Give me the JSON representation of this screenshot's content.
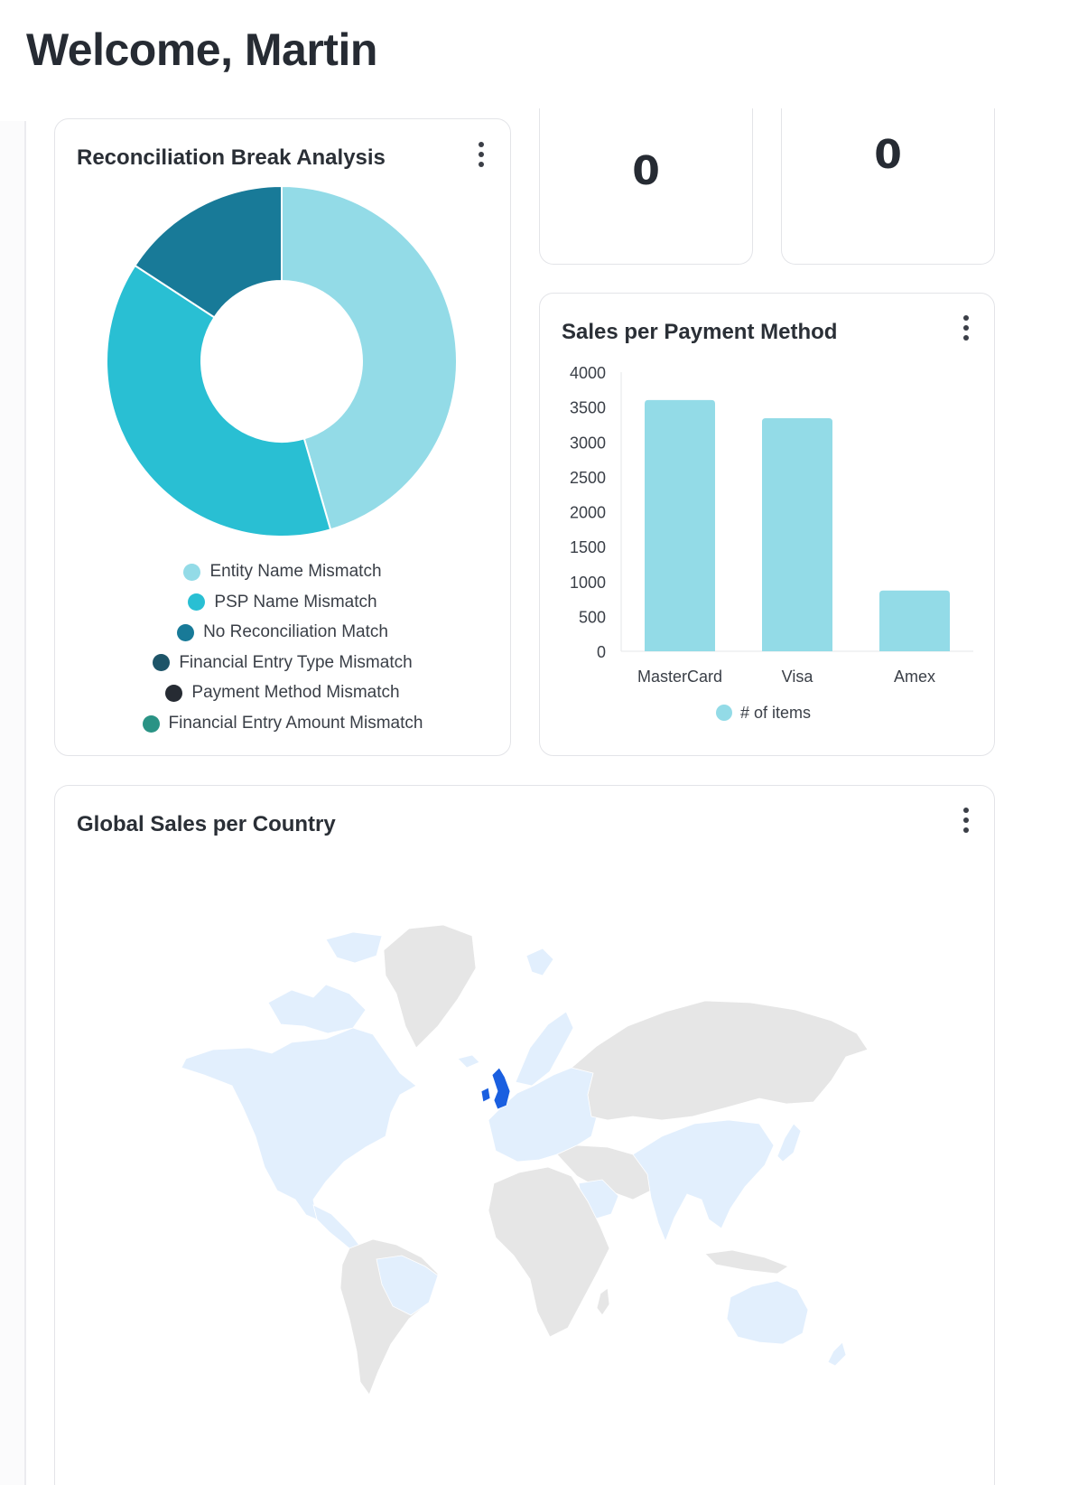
{
  "header": {
    "title": "Welcome, Martin"
  },
  "stats": [
    {
      "value": "0"
    },
    {
      "value": "0"
    }
  ],
  "recon": {
    "title": "Reconciliation Break Analysis",
    "legend": [
      {
        "label": "Entity Name Mismatch",
        "color": "#93dbe7"
      },
      {
        "label": "PSP Name Mismatch",
        "color": "#29bfd3"
      },
      {
        "label": "No Reconciliation Match",
        "color": "#187a98"
      },
      {
        "label": "Financial Entry Type Mismatch",
        "color": "#1d5468"
      },
      {
        "label": "Payment Method Mismatch",
        "color": "#262b33"
      },
      {
        "label": "Financial Entry Amount Mismatch",
        "color": "#2a9385"
      }
    ]
  },
  "sales": {
    "title": "Sales per Payment Method",
    "legend_label": "# of items",
    "bar_color": "#93dbe7"
  },
  "map": {
    "title": "Global Sales per Country",
    "highlight_color": "#1a5fe0",
    "sales_color": "#e2effd",
    "base_color": "#e6e6e6"
  },
  "chart_data": [
    {
      "type": "pie",
      "title": "Reconciliation Break Analysis",
      "categories": [
        "Entity Name Mismatch",
        "PSP Name Mismatch",
        "No Reconciliation Match",
        "Financial Entry Type Mismatch",
        "Payment Method Mismatch",
        "Financial Entry Amount Mismatch"
      ],
      "values": [
        45.5,
        38.7,
        15.8,
        0,
        0,
        0
      ],
      "colors": [
        "#93dbe7",
        "#29bfd3",
        "#187a98",
        "#1d5468",
        "#262b33",
        "#2a9385"
      ],
      "legend_position": "bottom"
    },
    {
      "type": "bar",
      "title": "Sales per Payment Method",
      "categories": [
        "MasterCard",
        "Visa",
        "Amex"
      ],
      "series": [
        {
          "name": "# of items",
          "values": [
            3600,
            3340,
            870
          ]
        }
      ],
      "yticks": [
        "0",
        "500",
        "1000",
        "1500",
        "2000",
        "2500",
        "3000",
        "3500",
        "4000"
      ],
      "ylim": [
        0,
        4000
      ],
      "legend_position": "bottom"
    }
  ]
}
